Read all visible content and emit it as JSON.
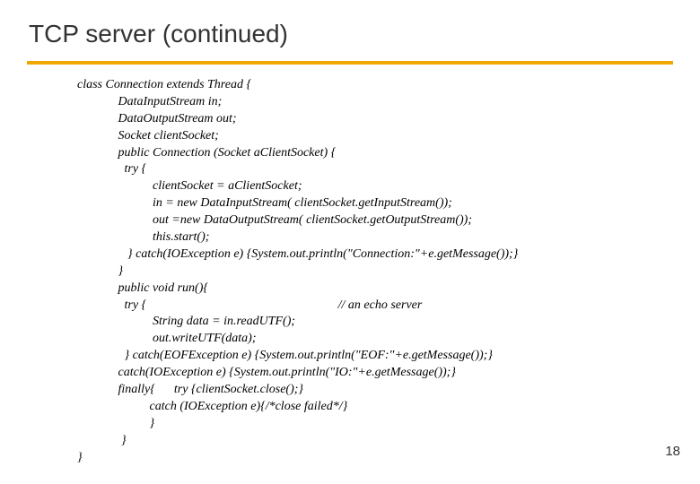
{
  "slide": {
    "title": "TCP server (continued)",
    "page_number": "18",
    "code_lines": [
      "class Connection extends Thread {",
      "             DataInputStream in;",
      "             DataOutputStream out;",
      "             Socket clientSocket;",
      "             public Connection (Socket aClientSocket) {",
      "               try {",
      "                        clientSocket = aClientSocket;",
      "                        in = new DataInputStream( clientSocket.getInputStream());",
      "                        out =new DataOutputStream( clientSocket.getOutputStream());",
      "                        this.start();",
      "                } catch(IOException e) {System.out.println(\"Connection:\"+e.getMessage());}",
      "             }",
      "             public void run(){",
      "               try {                                                             // an echo server",
      "                        String data = in.readUTF();",
      "                        out.writeUTF(data);",
      "               } catch(EOFException e) {System.out.println(\"EOF:\"+e.getMessage());}",
      "             catch(IOException e) {System.out.println(\"IO:\"+e.getMessage());}",
      "             finally{      try {clientSocket.close();}",
      "                       catch (IOException e){/*close failed*/}",
      "                       }",
      "              }",
      "}"
    ]
  }
}
